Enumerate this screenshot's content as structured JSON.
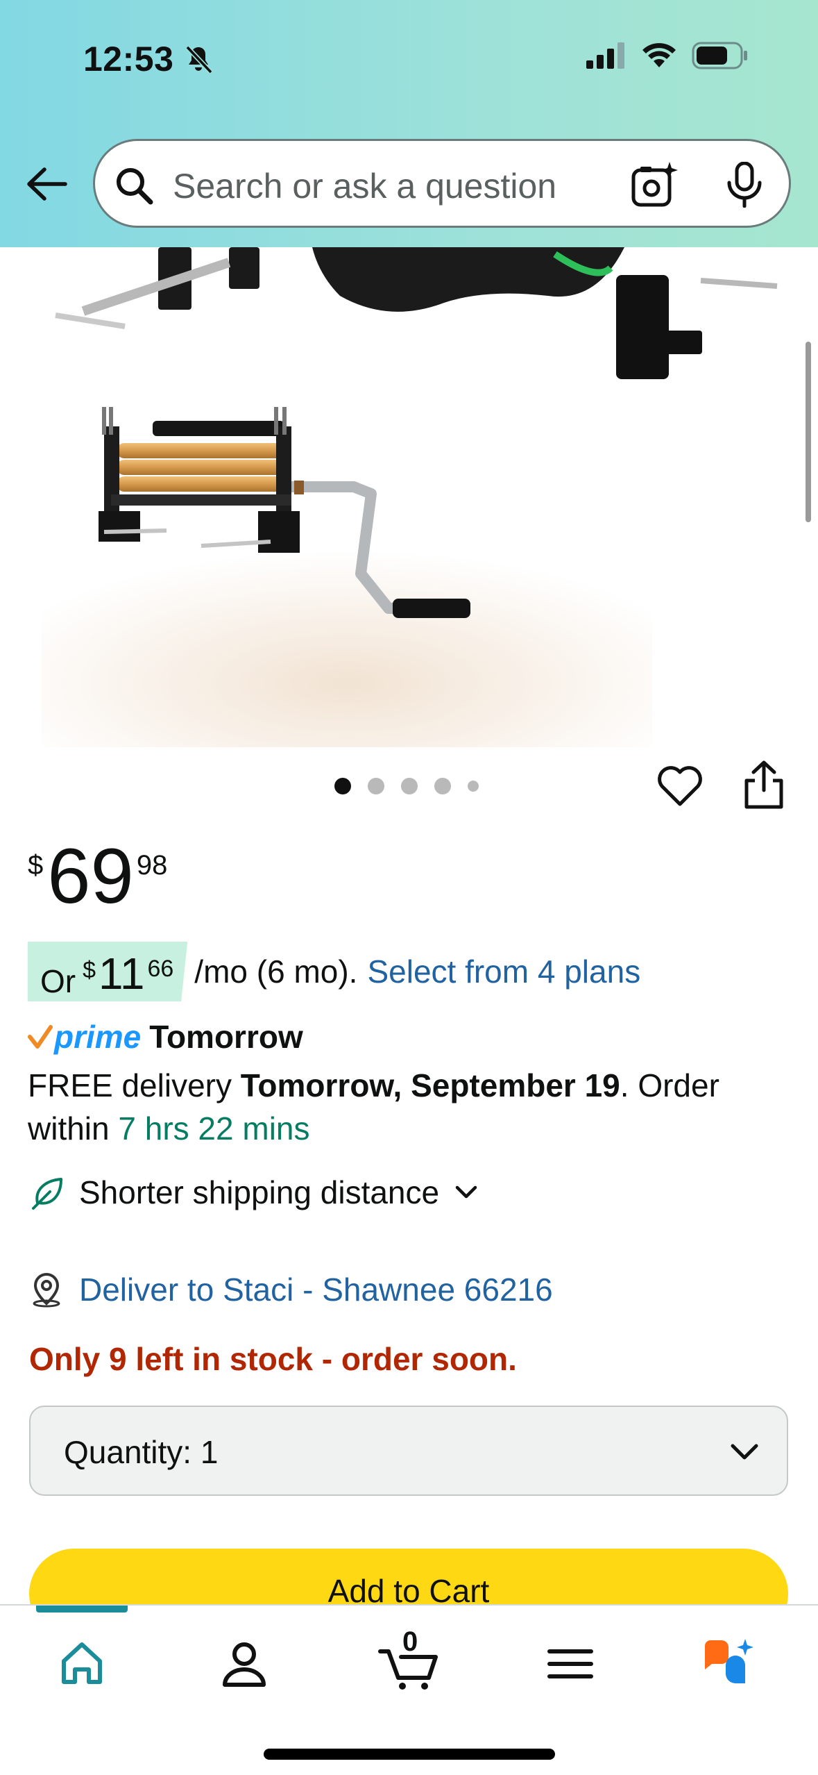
{
  "status_bar": {
    "time": "12:53"
  },
  "header": {
    "search_placeholder": "Search or ask a question"
  },
  "carousel": {
    "total_images": 5,
    "active_index": 0
  },
  "price": {
    "symbol": "$",
    "whole": "69",
    "fraction": "98"
  },
  "installment": {
    "prefix": "Or",
    "symbol": "$",
    "whole": "11",
    "fraction": "66",
    "term": "/mo (6 mo).",
    "link": "Select from 4 plans"
  },
  "prime": {
    "word": "prime",
    "day": "Tomorrow"
  },
  "delivery": {
    "free_text": "FREE delivery",
    "date": "Tomorrow, September 19",
    "order_text": ". Order within",
    "countdown": "7 hrs 22 mins"
  },
  "shipping": {
    "label": "Shorter shipping distance"
  },
  "deliver_to": {
    "label": "Deliver to Staci - Shawnee 66216"
  },
  "stock": {
    "text": "Only 9 left in stock - order soon."
  },
  "quantity": {
    "label": "Quantity:",
    "value": "1"
  },
  "add_to_cart": {
    "label": "Add to Cart"
  },
  "bottom_nav": {
    "cart_count": "0",
    "active": "home"
  },
  "colors": {
    "link": "#2162a1",
    "stock": "#b12704",
    "countdown": "#067d62",
    "prime": "#1a98ff",
    "add_to_cart": "#ffd814",
    "installment_badge": "#c8f0e0",
    "nav_accent": "#1a8c9a"
  }
}
